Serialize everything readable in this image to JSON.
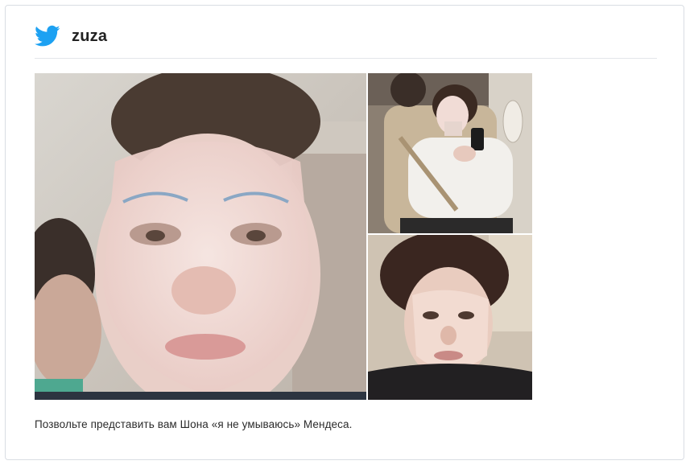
{
  "post": {
    "username": "zuza",
    "caption": "Позвольте представить вам Шона «я не умываюсь» Мендеса.",
    "icon": "twitter-bird-icon"
  },
  "colors": {
    "twitter_blue": "#1da1f2",
    "card_border": "#d9dde3",
    "divider": "#e3e6ea",
    "text": "#2b2b2b"
  },
  "photos": [
    {
      "id": "main",
      "subject": "selfie-face-sheet-mask"
    },
    {
      "id": "top-right",
      "subject": "airplane-seat-phone"
    },
    {
      "id": "bottom-right",
      "subject": "selfie-face-mask-dark-hair"
    }
  ]
}
